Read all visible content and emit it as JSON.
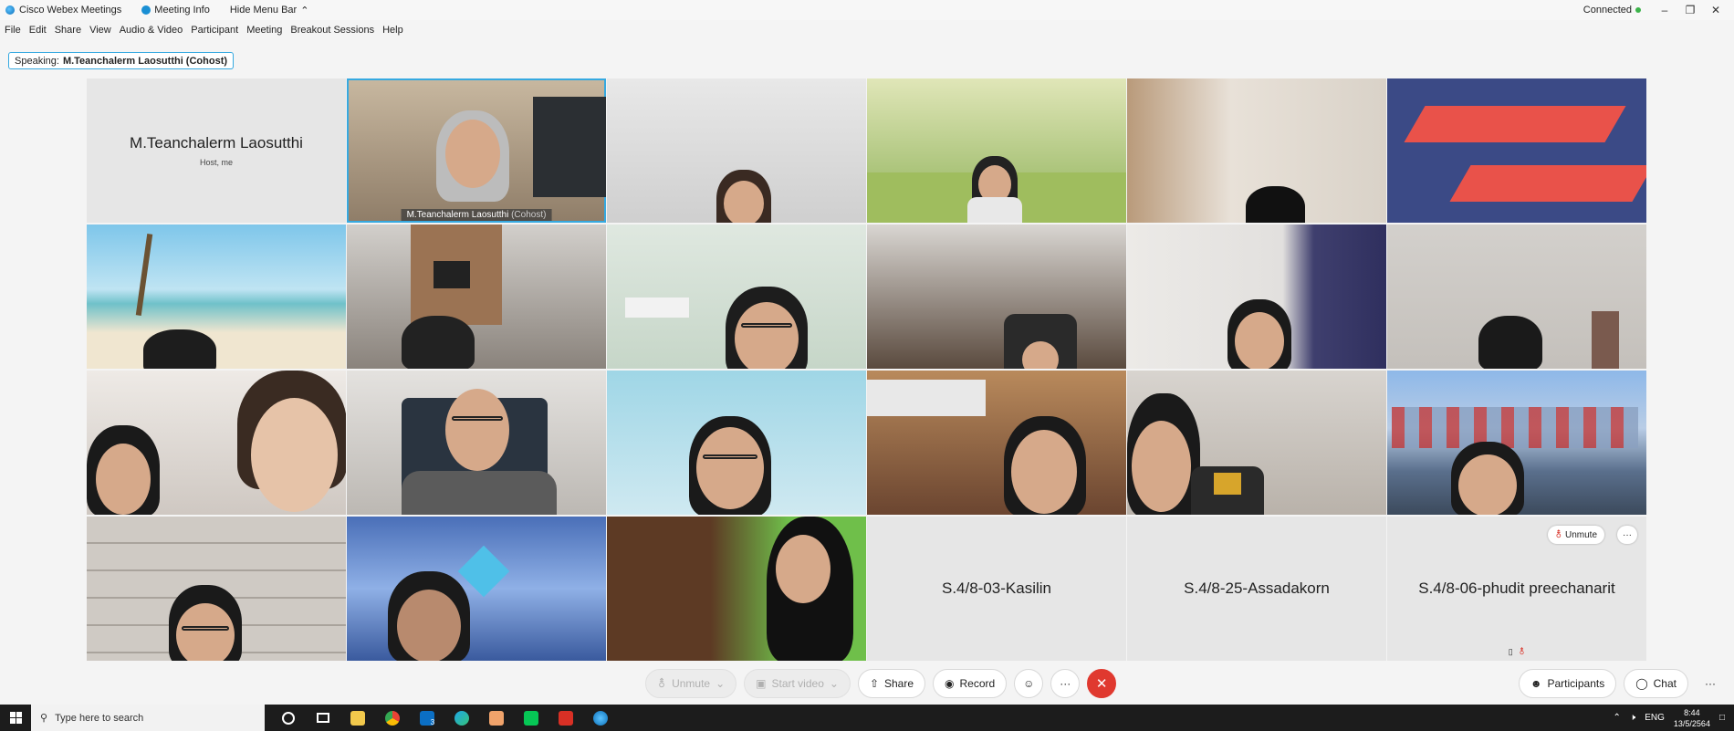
{
  "titlebar": {
    "app_name": "Cisco Webex Meetings",
    "meeting_info": "Meeting Info",
    "hide_menu": "Hide Menu Bar",
    "connection": "Connected"
  },
  "menu": [
    "File",
    "Edit",
    "Share",
    "View",
    "Audio & Video",
    "Participant",
    "Meeting",
    "Breakout Sessions",
    "Help"
  ],
  "speaking": {
    "prefix": "Speaking:",
    "name": "M.Teanchalerm Laosutthi (Cohost)"
  },
  "tiles": {
    "host_name": "M.Teanchalerm Laosutthi",
    "host_sub": "Host, me",
    "cohost_tag_name": "M.Teanchalerm Laosutthi",
    "cohost_tag_role": "(Cohost)",
    "kasilin": "S.4/8-03-Kasilin",
    "assadakorn": "S.4/8-25-Assadakorn",
    "phudit": "S.4/8-06-phudit preechanarit",
    "unmute_label": "Unmute",
    "more_label": "···"
  },
  "controls": {
    "unmute": "Unmute",
    "start_video": "Start video",
    "share": "Share",
    "record": "Record",
    "participants": "Participants",
    "chat": "Chat"
  },
  "taskbar": {
    "search_placeholder": "Type here to search",
    "lang": "ENG",
    "time": "8:44",
    "date": "13/5/2564",
    "mail_badge": "3"
  },
  "colors": {
    "accent": "#36a9e0",
    "end_call": "#e0392f",
    "connected": "#3cb34a"
  }
}
